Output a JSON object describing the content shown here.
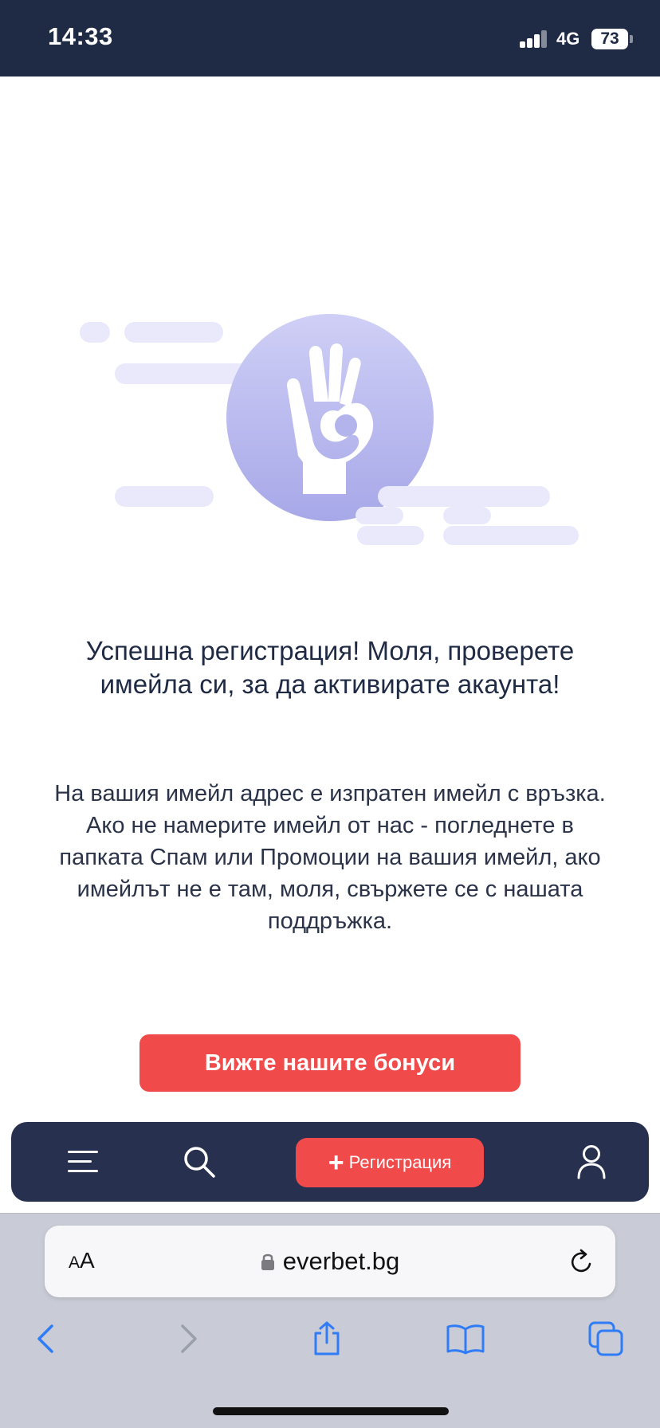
{
  "status_bar": {
    "time": "14:33",
    "network": "4G",
    "battery": "73"
  },
  "message": {
    "title": "Успешна регистрация! Моля, проверете имейла си, за да активирате акаунта!",
    "body": "На вашия имейл адрес е изпратен имейл с връзка. Ако не намерите имейл от нас - погледнете в папката Спам или Промоции на вашия имейл, ако имейлът не е там, моля, свържете се с нашата поддръжка."
  },
  "bonus_button": {
    "label": "Вижте нашите бонуси"
  },
  "bottom_nav": {
    "menu_icon": "hamburger-menu-icon",
    "search_icon": "search-icon",
    "register_label": "Регистрация",
    "profile_icon": "user-icon"
  },
  "browser": {
    "text_size_label_small": "A",
    "text_size_label_large": "A",
    "url": "everbet.bg",
    "toolbar": [
      "back-icon",
      "forward-icon",
      "share-icon",
      "bookmarks-icon",
      "tabs-icon"
    ]
  },
  "colors": {
    "status_bar": "#1f2a44",
    "accent_red": "#f04a4a",
    "nav_background": "#28304f",
    "illustration_purple": "#a7a8e8",
    "safari_blue": "#2f7cf6"
  }
}
